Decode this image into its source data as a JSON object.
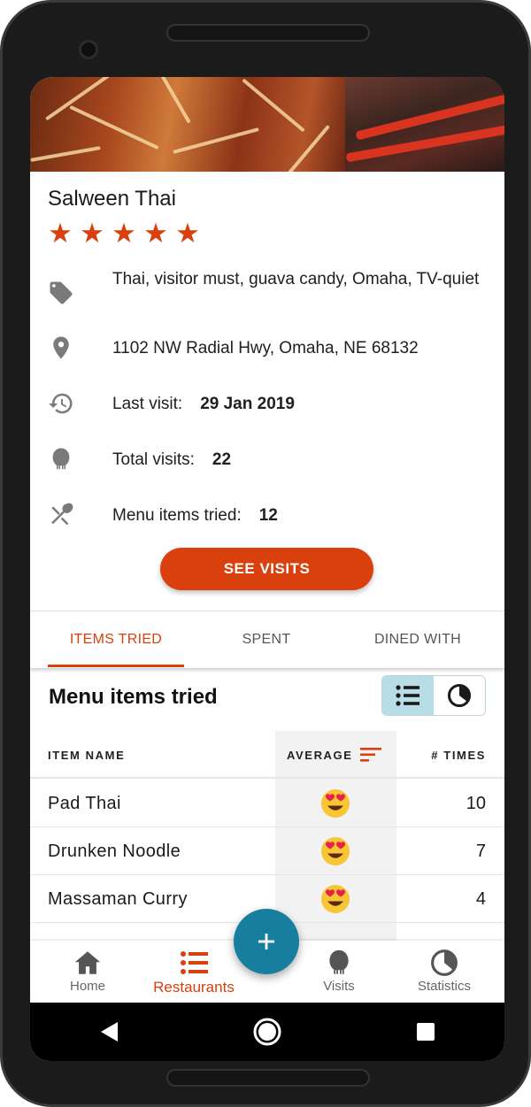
{
  "restaurant": {
    "name": "Salween Thai",
    "rating": 5,
    "rating_max": 5,
    "tags": "Thai, visitor must, guava candy, Omaha, TV-quiet",
    "address": "1102 NW Radial Hwy, Omaha, NE 68132",
    "last_visit_label": "Last visit:",
    "last_visit_value": "29 Jan 2019",
    "total_visits_label": "Total visits:",
    "total_visits_value": "22",
    "menu_items_label": "Menu items tried:",
    "menu_items_value": "12"
  },
  "actions": {
    "see_visits": "SEE VISITS"
  },
  "tabs": [
    {
      "label": "ITEMS TRIED",
      "active": true
    },
    {
      "label": "SPENT",
      "active": false
    },
    {
      "label": "DINED WITH",
      "active": false
    }
  ],
  "menu_section": {
    "title": "Menu items tried",
    "view_toggle": {
      "selected": "list",
      "options": [
        "list-icon",
        "pie-chart-icon"
      ]
    },
    "columns": {
      "item_name": "ITEM NAME",
      "average": "AVERAGE",
      "times": "# TIMES"
    },
    "rows": [
      {
        "name": "Pad Thai",
        "average_icon": "heart-eyes-emoji",
        "times": "10"
      },
      {
        "name": "Drunken Noodle",
        "average_icon": "heart-eyes-emoji",
        "times": "7"
      },
      {
        "name": "Massaman Curry",
        "average_icon": "heart-eyes-emoji",
        "times": "4"
      }
    ]
  },
  "fab": {
    "icon": "plus-icon"
  },
  "bottom_nav": [
    {
      "label": "Home",
      "icon": "home-icon",
      "active": false
    },
    {
      "label": "Restaurants",
      "icon": "list-icon",
      "active": true
    },
    {
      "label": "Visits",
      "icon": "spoon-icon",
      "active": false
    },
    {
      "label": "Statistics",
      "icon": "pie-chart-icon",
      "active": false
    }
  ],
  "colors": {
    "accent": "#d9400d",
    "fab": "#177ea0",
    "toggle_selected": "#b9dde6"
  }
}
